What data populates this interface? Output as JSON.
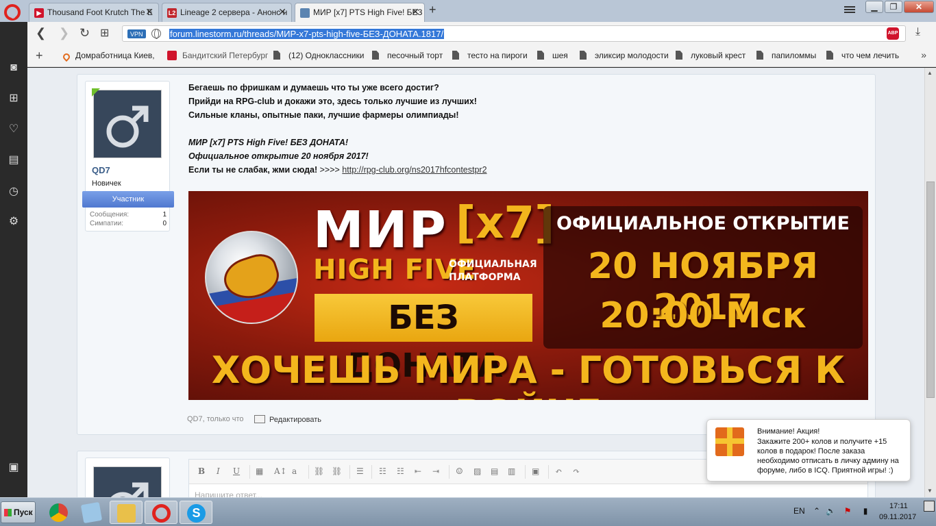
{
  "browser": {
    "tabs": [
      {
        "title": "Thousand Foot Krutch The E",
        "favicon_color": "#d0142c",
        "favicon": "▶"
      },
      {
        "title": "Lineage 2 сервера - Анонс н",
        "favicon_color": "#c1272d",
        "favicon": "L2"
      },
      {
        "title": "МИР [x7] PTS High Five! БЕЗ",
        "favicon_color": "#5b84b1",
        "favicon": ""
      }
    ],
    "url": "forum.linestorm.ru/threads/МИР-x7-pts-high-five-БЕЗ-ДОНАТА.1817/",
    "vpn_label": "VPN",
    "abp_label": "ABP"
  },
  "bookmarks": [
    {
      "label": "Домработница Киев,",
      "type": "heart"
    },
    {
      "label": "Бандитский Петербург",
      "type": "popcorn"
    },
    {
      "label": "(12) Одноклассники",
      "type": "doc"
    },
    {
      "label": "песочный торт",
      "type": "doc"
    },
    {
      "label": "тесто на пироги",
      "type": "doc"
    },
    {
      "label": "шея",
      "type": "doc"
    },
    {
      "label": "эликсир молодости",
      "type": "doc"
    },
    {
      "label": "луковый крест",
      "type": "doc"
    },
    {
      "label": "папиломмы",
      "type": "doc"
    },
    {
      "label": "что чем лечить",
      "type": "doc"
    }
  ],
  "post": {
    "username": "QD7",
    "user_title": "Новичек",
    "ribbon": "Участник",
    "stats": [
      {
        "label": "Сообщения:",
        "value": "1"
      },
      {
        "label": "Симпатии:",
        "value": "0"
      }
    ],
    "lines": [
      "Бегаешь по фришкам и думаешь что ты уже всего достиг?",
      "Прийди на RPG-club и докажи это, здесь только лучшие из лучших!",
      "Сильные кланы, опытные паки, лучшие фармеры олимпиады!"
    ],
    "italic_lines": [
      "МИР [x7] PTS High Five! БЕЗ ДОНАТА!",
      "Официальное открытие 20 ноября 2017!"
    ],
    "cta_text": "Если ты не слабак, жми сюда!",
    "cta_arrows": " >>>> ",
    "link": "http://rpg-club.org/ns2017hfcontestpr2",
    "footer_author": "QD7, только что",
    "footer_edit": "Редактировать"
  },
  "banner": {
    "mir": "МИР",
    "x7": "[x7]",
    "high_five": "HIGH FIVE",
    "platform": "ОФИЦИАЛЬНАЯ ПЛАТФОРМА",
    "no_donate": "БЕЗ ДОНАТА",
    "official_open": "ОФИЦИАЛЬНОЕ ОТКРЫТИЕ",
    "date": "20 НОЯБРЯ 2017",
    "time": "20:00 Мск",
    "slogan": "ХОЧЕШЬ МИРА - ГОТОВЬСЯ К ВОЙНЕ"
  },
  "editor": {
    "placeholder": "Напишите ответ..."
  },
  "toast": {
    "title": "Внимание! Акция!",
    "body": "Закажите 200+ колов и получите +15 колов в подарок! После заказа необходимо отписать в личку админу на форуме, либо в ICQ. Приятной игры! :)"
  },
  "taskbar": {
    "start": "Пуск",
    "lang": "EN",
    "time": "17:11",
    "date": "09.11.2017",
    "apps": [
      {
        "name": "chrome",
        "color": "#db4437"
      },
      {
        "name": "notepad",
        "color": "#7fb2d8"
      },
      {
        "name": "explorer",
        "color": "#e9c04a"
      },
      {
        "name": "opera",
        "color": "#e0231e"
      },
      {
        "name": "skype",
        "color": "#1a9be6"
      }
    ]
  }
}
